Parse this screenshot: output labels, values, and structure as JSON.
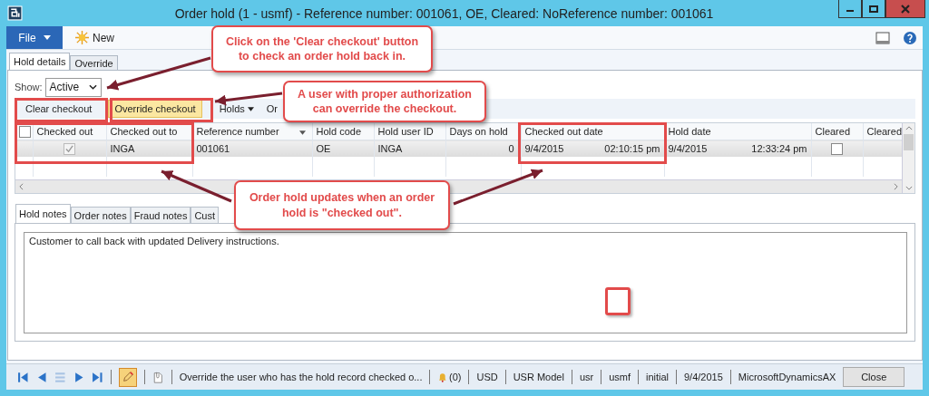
{
  "window": {
    "title": "Order hold (1 - usmf) - Reference number: 001061, OE, Cleared: NoReference number: 001061"
  },
  "menu": {
    "file": "File",
    "new": "New"
  },
  "tabs": [
    {
      "label": "Hold details",
      "selected": true
    },
    {
      "label": "Override",
      "selected": false
    }
  ],
  "show": {
    "label": "Show:",
    "value": "Active"
  },
  "actions": [
    {
      "label": "Clear checkout",
      "kind": "button"
    },
    {
      "label": "Override checkout",
      "kind": "highlighted"
    },
    {
      "label": "Holds",
      "kind": "menu"
    },
    {
      "label": "Or",
      "kind": "button"
    }
  ],
  "grid": {
    "select_all_checked": false,
    "columns": [
      "Checked out",
      "Checked out to",
      "Reference number",
      "Hold code",
      "Hold user ID",
      "Days on hold",
      "Checked out date",
      "Hold date",
      "Cleared",
      "Cleared"
    ],
    "rows": [
      {
        "checked_out": true,
        "checked_out_to": "INGA",
        "reference_number": "001061",
        "hold_code": "OE",
        "hold_user_id": "INGA",
        "days_on_hold": "0",
        "checked_out_date": "9/4/2015",
        "checked_out_time": "02:10:15 pm",
        "hold_date": "9/4/2015",
        "hold_time": "12:33:24 pm",
        "cleared": false
      }
    ]
  },
  "note_tabs": [
    {
      "label": "Hold notes",
      "selected": true
    },
    {
      "label": "Order notes",
      "selected": false
    },
    {
      "label": "Fraud notes",
      "selected": false
    },
    {
      "label": "Cust",
      "selected": false
    }
  ],
  "note_text": "Customer to call back with updated Delivery instructions.",
  "status_bar": {
    "help": "Override the user who has the hold record checked o...",
    "alerts": "(0)",
    "fields": [
      "USD",
      "USR Model",
      "usr",
      "usmf",
      "initial",
      "9/4/2015",
      "MicrosoftDynamicsAX"
    ],
    "close": "Close"
  },
  "callouts": [
    {
      "text": "Click on the 'Clear checkout' button to check an order hold back in."
    },
    {
      "text": "A user with proper authorization can override the checkout."
    },
    {
      "text": "Order hold updates when an order hold is \"checked out\"."
    }
  ]
}
